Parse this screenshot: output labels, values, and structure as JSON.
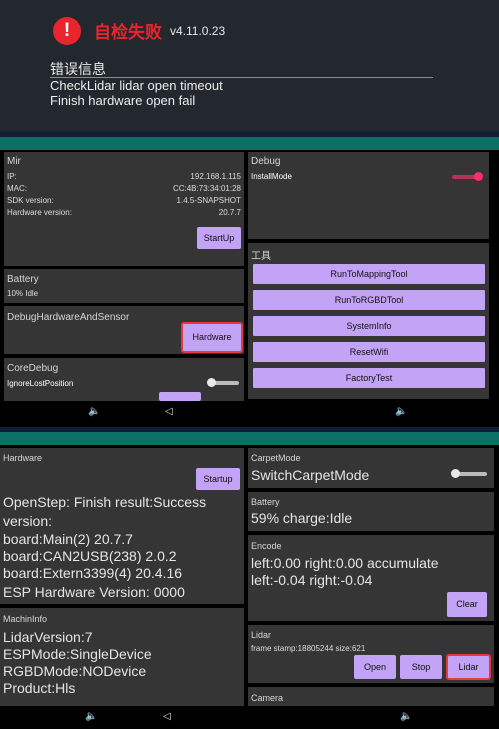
{
  "error_banner": {
    "title": "自检失败",
    "version": "v4.11.0.23",
    "section_label": "错误信息",
    "messages": [
      "CheckLidar lidar open timeout",
      "Finish hardware open fail"
    ]
  },
  "screen1": {
    "mir": {
      "title": "Mir",
      "rows": [
        {
          "label": "IP:",
          "value": "192.168.1.115"
        },
        {
          "label": "MAC:",
          "value": "CC:4B:73:34:01:28"
        },
        {
          "label": "SDK version:",
          "value": "1.4.5-SNAPSHOT"
        },
        {
          "label": "Hardware version:",
          "value": "20.7.7"
        }
      ],
      "startup_label": "StartUp"
    },
    "battery": {
      "title": "Battery",
      "status": "10% Idle"
    },
    "debug_hw": {
      "title": "DebugHardwareAndSensor",
      "button_label": "Hardware"
    },
    "core_debug": {
      "title": "CoreDebug",
      "ignore_label": "IgnoreLostPosition"
    },
    "debug": {
      "title": "Debug",
      "install_mode_label": "InstallMode"
    },
    "tools": {
      "title": "工具",
      "items": [
        "RunToMappingTool",
        "RunToRGBDTool",
        "SystemInfo",
        "ResetWifi",
        "FactoryTest"
      ]
    },
    "nav": {
      "volume": "🔈",
      "back": "◁"
    }
  },
  "screen2": {
    "hardware": {
      "title": "Hardware",
      "startup_label": "Startup",
      "lines": [
        "OpenStep: Finish result:Success",
        "version:",
        "board:Main(2) 20.7.7",
        "board:CAN2USB(238) 2.0.2",
        "board:Extern3399(4) 20.4.16",
        "ESP Hardware Version: 0000"
      ]
    },
    "machine_info": {
      "title": "MachinInfo",
      "lines": [
        "LidarVersion:7",
        "ESPMode:SingleDevice",
        "RGBDMode:NODevice",
        "Product:Hls"
      ]
    },
    "carpet": {
      "title": "CarpetMode",
      "label": "SwitchCarpetMode"
    },
    "battery": {
      "title": "Battery",
      "status": "59% charge:Idle"
    },
    "encode": {
      "title": "Encode",
      "lines": [
        "left:0.00 right:0.00 accumulate",
        "left:-0.04 right:-0.04"
      ],
      "clear_label": "Clear"
    },
    "lidar": {
      "title": "Lidar",
      "frame": "frame stamp:18805244 size:621",
      "buttons": [
        "Open",
        "Stop",
        "Lidar"
      ]
    },
    "camera": {
      "title": "Camera"
    },
    "nav": {
      "volume": "🔈",
      "back": "◁"
    }
  }
}
